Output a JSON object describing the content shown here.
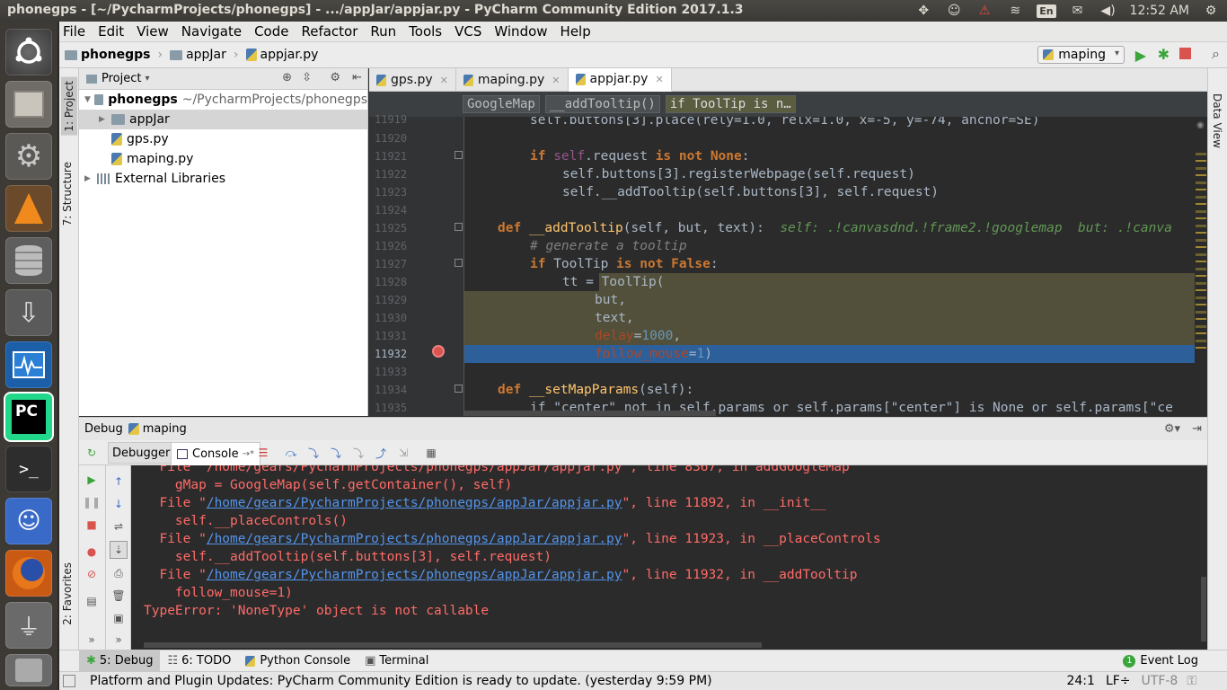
{
  "window_title": "phonegps - [~/PycharmProjects/phonegps] - .../appJar/appjar.py - PyCharm Community Edition 2017.1.3",
  "tray": {
    "lang": "En",
    "time": "12:52 AM"
  },
  "menu": [
    "File",
    "Edit",
    "View",
    "Navigate",
    "Code",
    "Refactor",
    "Run",
    "Tools",
    "VCS",
    "Window",
    "Help"
  ],
  "nav": {
    "crumbs": [
      "phonegps",
      "appJar",
      "appjar.py"
    ],
    "run_config": "maping"
  },
  "left_stripe": {
    "project": "1: Project",
    "structure": "7: Structure",
    "favorites": "2: Favorites"
  },
  "right_stripe": {
    "data_view": "Data View"
  },
  "project": {
    "header": "Project",
    "root_name": "phonegps",
    "root_path": "~/PycharmProjects/phonegps",
    "items": [
      {
        "label": "appJar",
        "kind": "folder"
      },
      {
        "label": "gps.py",
        "kind": "file"
      },
      {
        "label": "maping.py",
        "kind": "file"
      }
    ],
    "external": "External Libraries"
  },
  "tabs": [
    {
      "label": "gps.py"
    },
    {
      "label": "maping.py"
    },
    {
      "label": "appjar.py"
    }
  ],
  "code_breadcrumbs": [
    "GoogleMap",
    "__addTooltip()",
    "if ToolTip is n…"
  ],
  "code": {
    "line_numbers": [
      "11919",
      "11920",
      "11921",
      "11922",
      "11923",
      "11924",
      "11925",
      "11926",
      "11927",
      "11928",
      "11929",
      "11930",
      "11931",
      "11932",
      "11933",
      "11934",
      "11935"
    ],
    "l0": "self.buttons[3].place(rely=1.0, relx=1.0, x=-5, y=-74, anchor=SE)",
    "l2_kw": "if",
    "l2_a": "self",
    "l2_b": ".request",
    "l2_kw2": "is not",
    "l2_none": "None",
    "l2_c": ":",
    "l3": "self.buttons[3].registerWebpage(self.request)",
    "l4": "self.__addTooltip(self.buttons[3], self.request)",
    "l6_kw": "def",
    "l6_fn": "__addTooltip",
    "l6_args": "(self, but, text):",
    "l6_hint": "self: .!canvasdnd.!frame2.!googlemap  but: .!canva",
    "l7": "# generate a tooltip",
    "l8_kw": "if",
    "l8_a": "ToolTip",
    "l8_kw2": "is not",
    "l8_false": "False",
    "l8_c": ":",
    "l9": "tt = ToolTip(",
    "l10": "but,",
    "l11": "text,",
    "l12_p": "delay",
    "l12_v": "=",
    "l12_n": "1000",
    "l12_c": ",",
    "l13_p": "follow_mouse",
    "l13_v": "=",
    "l13_n": "1",
    "l13_c": ")",
    "l15_kw": "def",
    "l15_fn": "__setMapParams",
    "l15_args": "(self):",
    "l16": "if \"center\" not in self.params or self.params[\"center\"] is None or self.params[\"ce"
  },
  "debug": {
    "title": "Debug",
    "config": "maping",
    "tab_debugger": "Debugger",
    "tab_console": "Console"
  },
  "console": {
    "l0": "  File \"/home/gears/PycharmProjects/phonegps/appJar/appjar.py\", line 8367, in addGoogleMap",
    "l1": "    gMap = GoogleMap(self.getContainer(), self)",
    "l2_pre": "  File \"",
    "l2_link": "/home/gears/PycharmProjects/phonegps/appJar/appjar.py",
    "l2_post": "\", line 11892, in __init__",
    "l3": "    self.__placeControls()",
    "l4_pre": "  File \"",
    "l4_link": "/home/gears/PycharmProjects/phonegps/appJar/appjar.py",
    "l4_post": "\", line 11923, in __placeControls",
    "l5": "    self.__addTooltip(self.buttons[3], self.request)",
    "l6_pre": "  File \"",
    "l6_link": "/home/gears/PycharmProjects/phonegps/appJar/appjar.py",
    "l6_post": "\", line 11932, in __addTooltip",
    "l7": "    follow_mouse=1)",
    "l8": "TypeError: 'NoneType' object is not callable"
  },
  "bottom_tools": [
    {
      "label": "5: Debug"
    },
    {
      "label": "6: TODO"
    },
    {
      "label": "Python Console"
    },
    {
      "label": "Terminal"
    }
  ],
  "event_log": "Event Log",
  "event_count": "1",
  "status": {
    "message": "Platform and Plugin Updates: PyCharm Community Edition is ready to update. (yesterday 9:59 PM)",
    "position": "24:1",
    "line_sep": "LF÷",
    "encoding": "UTF-8"
  }
}
